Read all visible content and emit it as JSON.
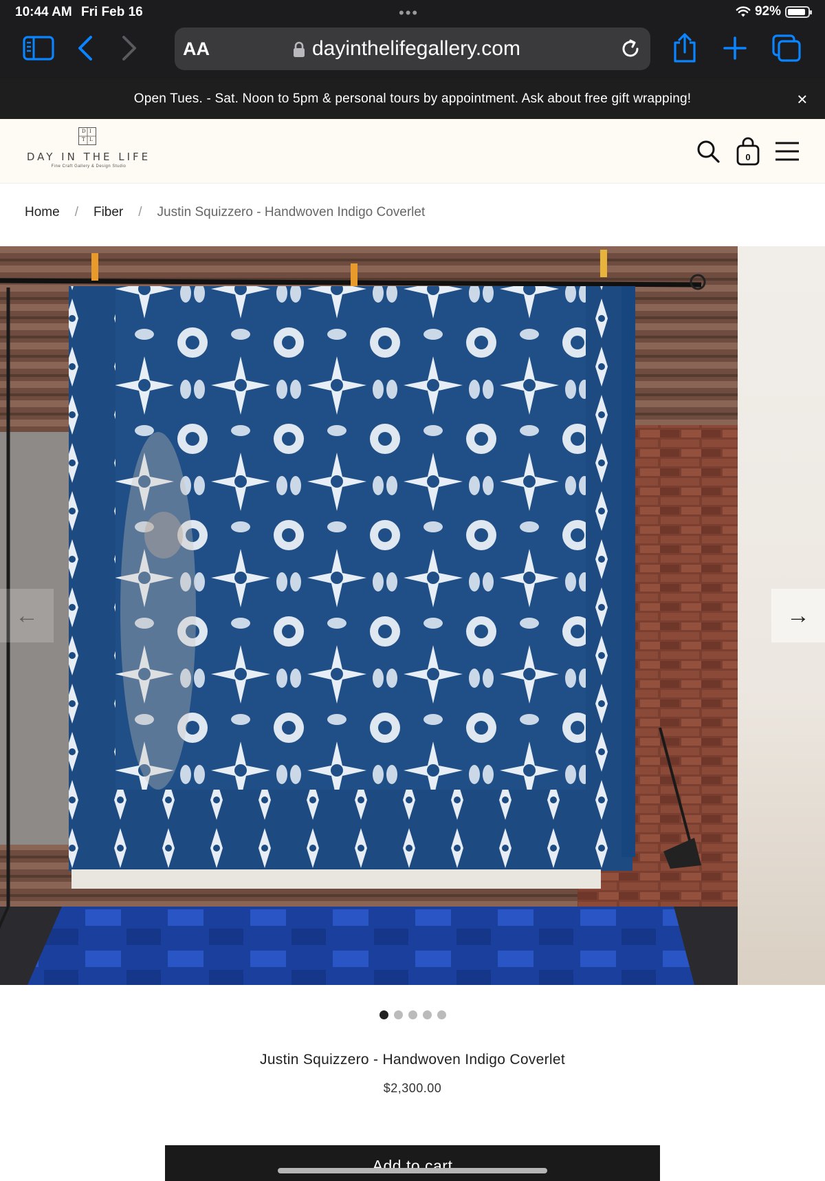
{
  "status_bar": {
    "time": "10:44 AM",
    "date": "Fri Feb 16",
    "battery": "92%",
    "battery_level": 0.92
  },
  "browser": {
    "text_size_label": "AA",
    "url": "dayinthelifegallery.com",
    "icons": [
      "sidebar-icon",
      "back-icon",
      "forward-icon",
      "lock-icon",
      "reload-icon",
      "share-icon",
      "new-tab-icon",
      "tabs-icon"
    ]
  },
  "announcement": {
    "text": "Open Tues. - Sat. Noon to 5pm & personal tours by appointment. Ask about free gift wrapping!",
    "close_icon": "×"
  },
  "header": {
    "logo_mark_letters": [
      "D",
      "I",
      "L",
      "T"
    ],
    "logo_name": "DAY IN THE LIFE",
    "logo_tagline": "Fine Craft Gallery & Design Studio",
    "cart_count": "0"
  },
  "breadcrumb": {
    "items": [
      "Home",
      "Fiber",
      "Justin Squizzero - Handwoven Indigo Coverlet"
    ],
    "separator": "/"
  },
  "gallery": {
    "prev_arrow": "←",
    "next_arrow": "→",
    "slide_count": 5,
    "active_index": 0
  },
  "product": {
    "title": "Justin Squizzero - Handwoven Indigo Coverlet",
    "price": "$2,300.00",
    "add_to_cart": "Add to cart"
  },
  "colors": {
    "indigo": "#1f4f86",
    "cream_header": "#fdfbf4",
    "dark_bar": "#1e1e1e",
    "accent_blue": "#0a84ff"
  }
}
